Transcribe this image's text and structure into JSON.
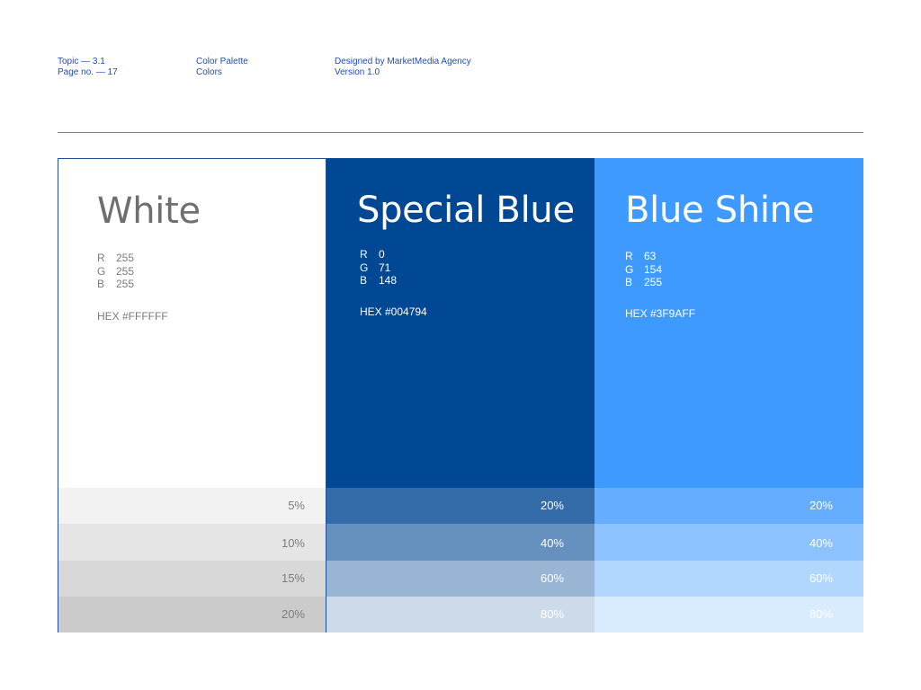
{
  "header": {
    "topic": "Topic — 3.1",
    "page": "Page no. — 17",
    "section_title": "Color Palette",
    "section_subtitle": "Colors",
    "designer": "Designed by MarketMedia Agency",
    "version": "Version 1.0"
  },
  "colors": [
    {
      "name": "White",
      "r": "255",
      "g": "255",
      "b": "255",
      "hex_label": "HEX #FFFFFF",
      "swatch": "#FFFFFF",
      "tints": [
        {
          "label": "5%",
          "color": "#F2F2F2"
        },
        {
          "label": "10%",
          "color": "#E5E5E5"
        },
        {
          "label": "15%",
          "color": "#D8D8D8"
        },
        {
          "label": "20%",
          "color": "#CBCBCB"
        }
      ]
    },
    {
      "name": "Special Blue",
      "r": "0",
      "g": "71",
      "b": "148",
      "hex_label": "HEX #004794",
      "swatch": "#004794",
      "tints": [
        {
          "label": "20%",
          "color": "#336CA9"
        },
        {
          "label": "40%",
          "color": "#6691BF"
        },
        {
          "label": "60%",
          "color": "#99B5D4"
        },
        {
          "label": "80%",
          "color": "#CCDAEA"
        }
      ]
    },
    {
      "name": "Blue Shine",
      "r": "63",
      "g": "154",
      "b": "255",
      "hex_label": "HEX #3F9AFF",
      "swatch": "#3F9AFF",
      "tints": [
        {
          "label": "20%",
          "color": "#65AEFF"
        },
        {
          "label": "40%",
          "color": "#8CC2FF"
        },
        {
          "label": "60%",
          "color": "#B2D7FF"
        },
        {
          "label": "80%",
          "color": "#D9EBFF"
        }
      ]
    }
  ],
  "labels": {
    "r": "R",
    "g": "G",
    "b": "B"
  },
  "accent_color": "#1F4FA8"
}
